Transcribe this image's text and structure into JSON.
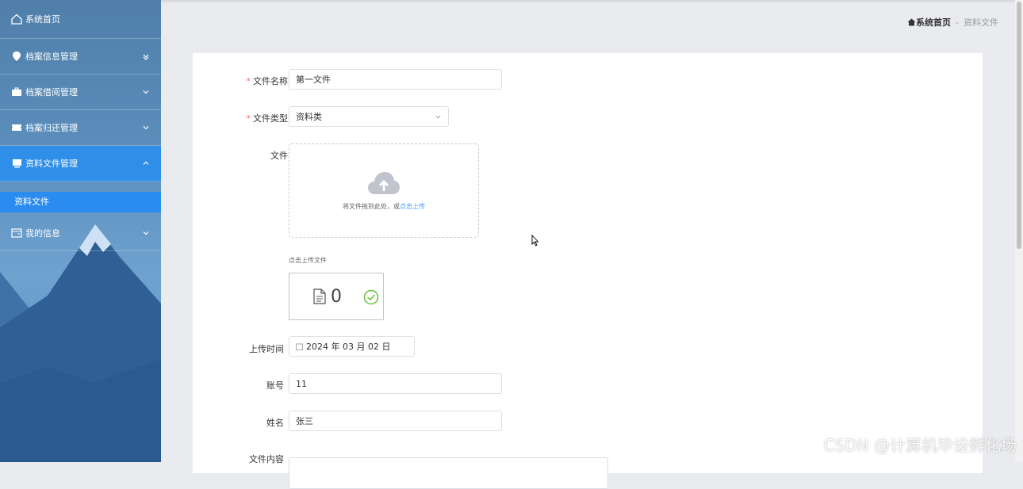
{
  "sidebar": {
    "home_label": "系统首页",
    "items": [
      {
        "label": "档案信息管理"
      },
      {
        "label": "档案借阅管理"
      },
      {
        "label": "档案归还管理"
      },
      {
        "label": "资料文件管理"
      },
      {
        "label": "我的信息"
      }
    ],
    "sub_item": "资料文件",
    "active_color": "#2e8ee8"
  },
  "breadcrumb": {
    "home": "系统首页",
    "separator": "-",
    "current": "资料文件"
  },
  "form": {
    "file_name": {
      "label": "文件名称",
      "value": "第一文件"
    },
    "file_type": {
      "label": "文件类型",
      "value": "资料类"
    },
    "file": {
      "label": "文件",
      "drop_tip": "将文件拖到此处，或",
      "drop_link": "点击上传",
      "hint": "点击上传文件",
      "count": "0"
    },
    "upload_time": {
      "label": "上传时间",
      "value": "2024 年 03 月 02 日"
    },
    "account": {
      "label": "账号",
      "value": "11"
    },
    "name": {
      "label": "姓名",
      "value": "张三"
    },
    "content": {
      "label": "文件内容"
    }
  },
  "watermark": "CSDN @计算机毕设孵化场",
  "icons": [
    "home-icon",
    "location-icon",
    "briefcase-icon",
    "ticket-icon",
    "box-icon",
    "card-icon",
    "chevron-down-icon",
    "chevron-up-icon",
    "upload-cloud-icon",
    "document-icon",
    "check-circle-icon",
    "calendar-icon"
  ]
}
